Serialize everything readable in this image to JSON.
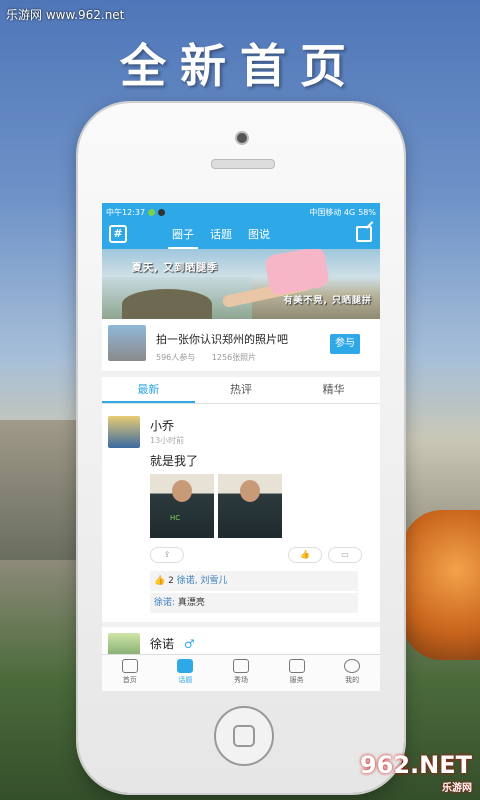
{
  "watermark_top": "乐游网 www.962.net",
  "headline": "全新首页",
  "statusbar": {
    "time": "中午12:37",
    "carrier": "中国移动 4G",
    "battery": "58%"
  },
  "navbar": {
    "left_icon": "#",
    "tabs": [
      {
        "label": "圈子"
      },
      {
        "label": "话题"
      },
      {
        "label": "图说"
      }
    ],
    "active_tab": "圈子"
  },
  "banner": {
    "caption_top": "夏天, 又到晒腿季",
    "caption_bottom": "有美不晃, 只晒腿拼"
  },
  "topic": {
    "title": "拍一张你认识郑州的照片吧",
    "participants": "596人参与",
    "photos": "1256张照片",
    "join_label": "参与"
  },
  "subtabs": [
    {
      "label": "最新"
    },
    {
      "label": "热评"
    },
    {
      "label": "精华"
    }
  ],
  "post": {
    "author": "小乔",
    "time": "13小时前",
    "text": "就是我了",
    "photo_logo": "HC",
    "likes_count": "2",
    "likes_names": "徐诺, 刘雪儿",
    "comment_author": "徐诺:",
    "comment_text": "真漂亮"
  },
  "post2": {
    "author": "徐诺",
    "gender_symbol": "♂"
  },
  "bottombar": [
    {
      "label": "首页",
      "icon": "home-icon"
    },
    {
      "label": "话题",
      "icon": "chat-icon"
    },
    {
      "label": "秀场",
      "icon": "video-icon"
    },
    {
      "label": "服务",
      "icon": "grid-icon"
    },
    {
      "label": "我的",
      "icon": "person-icon"
    }
  ],
  "watermark_bottom": {
    "brand": "962.NET",
    "sub": "乐游网"
  },
  "colors": {
    "accent": "#2fa8e8"
  }
}
